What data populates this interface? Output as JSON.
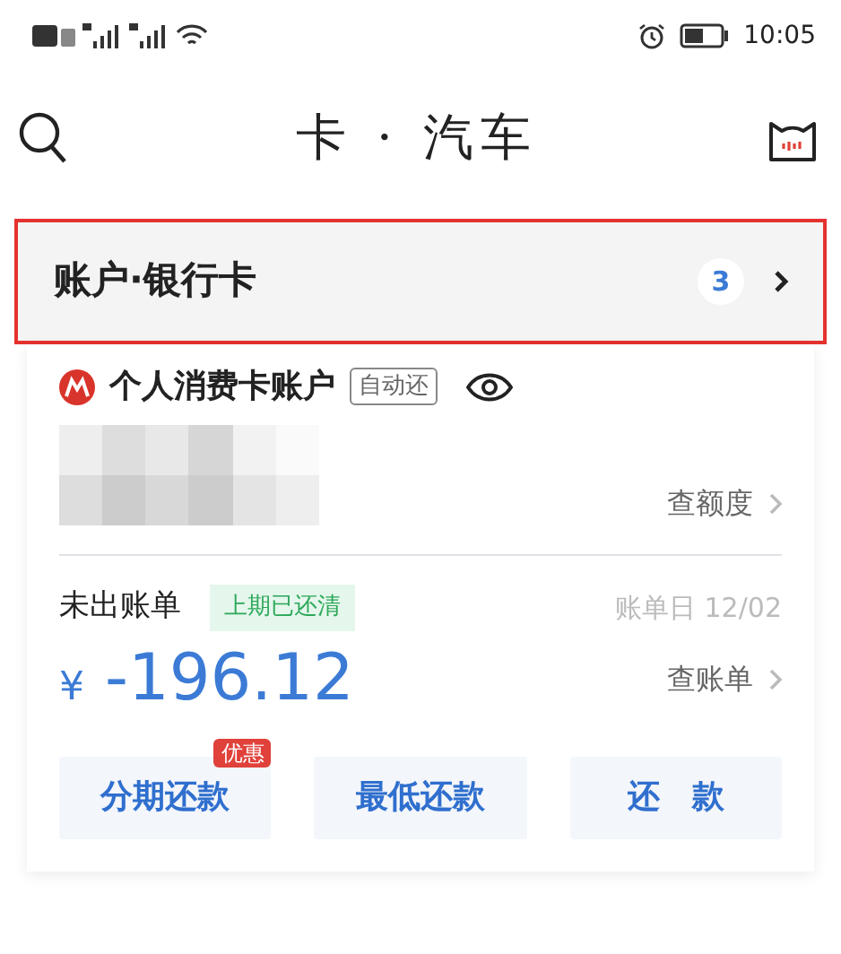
{
  "status_bar": {
    "time": "10:05"
  },
  "header": {
    "title": "卡 · 汽车"
  },
  "section": {
    "title": "账户·银行卡",
    "count": "3",
    "highlighted": true
  },
  "account": {
    "name": "个人消费卡账户",
    "tag": "自动还",
    "quota_link": "查额度"
  },
  "bill": {
    "label": "未出账单",
    "status": "上期已还清",
    "date": "账单日 12/02",
    "currency": "¥",
    "amount": "-196.12",
    "bill_link": "查账单"
  },
  "actions": [
    {
      "label": "分期还款",
      "badge": "优惠"
    },
    {
      "label": "最低还款"
    },
    {
      "label": "还　款"
    }
  ]
}
